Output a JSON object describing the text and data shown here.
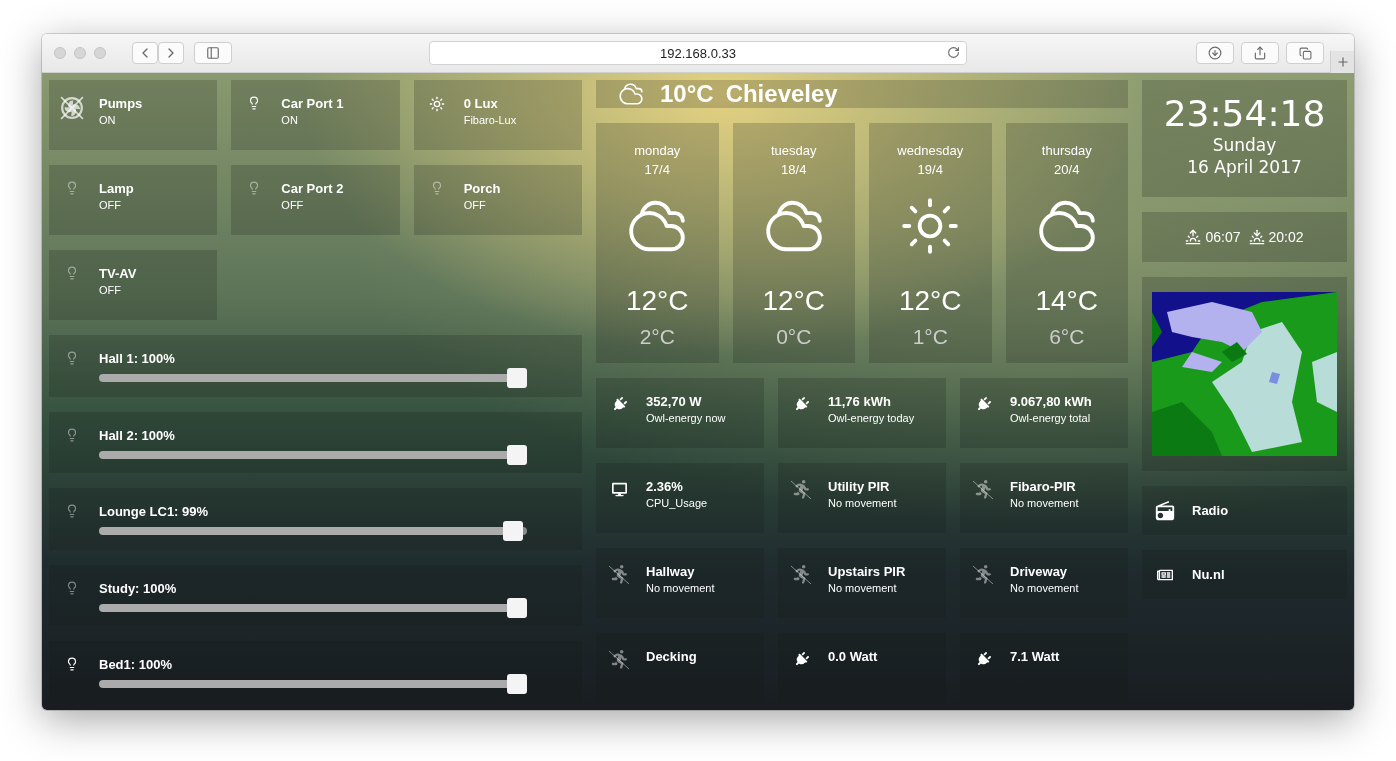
{
  "browser": {
    "url": "192.168.0.33"
  },
  "switches": [
    {
      "kind": "fan",
      "title": "Pumps",
      "status": "ON",
      "on": true
    },
    {
      "kind": "bulb",
      "title": "Car Port 1",
      "status": "ON",
      "on": true
    },
    {
      "kind": "sun",
      "title": "0 Lux",
      "status": "Fibaro-Lux",
      "on": true
    },
    {
      "kind": "bulb",
      "title": "Lamp",
      "status": "OFF",
      "on": false
    },
    {
      "kind": "bulb",
      "title": "Car Port 2",
      "status": "OFF",
      "on": false
    },
    {
      "kind": "bulb",
      "title": "Porch",
      "status": "OFF",
      "on": false
    },
    {
      "kind": "bulb",
      "title": "TV-AV",
      "status": "OFF",
      "on": false
    }
  ],
  "dimmers": [
    {
      "label": "Hall 1: 100%",
      "level": 1,
      "on": false
    },
    {
      "label": "Hall 2: 100%",
      "level": 1,
      "on": false
    },
    {
      "label": "Lounge LC1: 99%",
      "level": 0.99,
      "on": false
    },
    {
      "label": "Study: 100%",
      "level": 1,
      "on": false
    },
    {
      "label": "Bed1: 100%",
      "level": 1,
      "on": true
    }
  ],
  "weather": {
    "temperature": "10°C",
    "location": "Chieveley"
  },
  "forecast": [
    {
      "day": "monday",
      "date": "17/4",
      "kind": "cloudy",
      "high": "12°C",
      "low": "2°C"
    },
    {
      "day": "tuesday",
      "date": "18/4",
      "kind": "cloudy",
      "high": "12°C",
      "low": "0°C"
    },
    {
      "day": "wednesday",
      "date": "19/4",
      "kind": "sunny",
      "high": "12°C",
      "low": "1°C"
    },
    {
      "day": "thursday",
      "date": "20/4",
      "kind": "cloudy",
      "high": "14°C",
      "low": "6°C"
    }
  ],
  "sensors": [
    {
      "kind": "plug",
      "value": "352,70 W",
      "label": "Owl-energy now"
    },
    {
      "kind": "plug",
      "value": "11,76 kWh",
      "label": "Owl-energy today"
    },
    {
      "kind": "plug",
      "value": "9.067,80 kWh",
      "label": "Owl-energy total"
    },
    {
      "kind": "monitor",
      "value": "2.36%",
      "label": "CPU_Usage"
    },
    {
      "kind": "motion",
      "value": "Utility PIR",
      "label": "No movement"
    },
    {
      "kind": "motion",
      "value": "Fibaro-PIR",
      "label": "No movement"
    },
    {
      "kind": "motion",
      "value": "Hallway",
      "label": "No movement"
    },
    {
      "kind": "motion",
      "value": "Upstairs PIR",
      "label": "No movement"
    },
    {
      "kind": "motion",
      "value": "Driveway",
      "label": "No movement"
    },
    {
      "kind": "motion",
      "value": "Decking"
    },
    {
      "kind": "plug",
      "value": "0.0 Watt"
    },
    {
      "kind": "plug",
      "value": "7.1 Watt"
    }
  ],
  "clock": {
    "time": "23:54:18",
    "day": "Sunday",
    "date": "16 April 2017"
  },
  "sun": {
    "sunrise": "06:07",
    "sunset": "20:02"
  },
  "links": [
    {
      "kind": "radio",
      "label": "Radio"
    },
    {
      "kind": "news",
      "label": "Nu.nl"
    }
  ]
}
